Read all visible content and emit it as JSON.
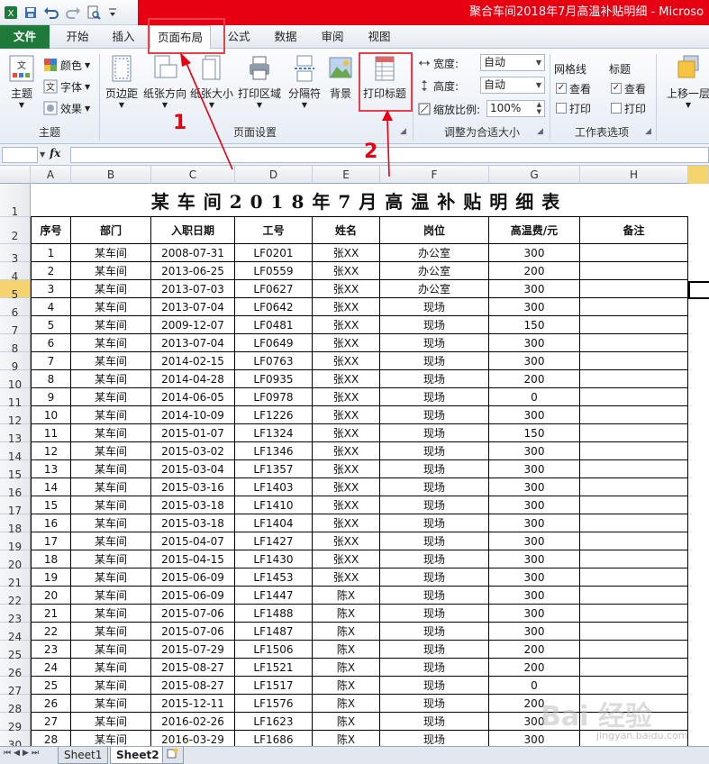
{
  "window": {
    "title": "聚合车间2018年7月高温补贴明细 - Microso"
  },
  "colors": {
    "title_bar_red": "#e60012",
    "file_tab": "#1d7a3a",
    "annotation_red": "#e60012"
  },
  "ribbon_tabs": [
    {
      "label": "文件"
    },
    {
      "label": "开始"
    },
    {
      "label": "插入"
    },
    {
      "label": "页面布局",
      "active": true
    },
    {
      "label": "公式"
    },
    {
      "label": "数据"
    },
    {
      "label": "审阅"
    },
    {
      "label": "视图"
    }
  ],
  "ribbon": {
    "theme": {
      "themes": "主题",
      "colors": "颜色",
      "fonts": "字体",
      "effects": "效果",
      "group": "主题"
    },
    "page_setup": {
      "margins": "页边距",
      "orientation": "纸张方向",
      "size": "纸张大小",
      "print_area": "打印区域",
      "breaks": "分隔符",
      "background": "背景",
      "print_titles": "打印标题",
      "group": "页面设置"
    },
    "scale": {
      "width_label": "宽度:",
      "width_value": "自动",
      "height_label": "高度:",
      "height_value": "自动",
      "scale_label": "缩放比例:",
      "scale_value": "100%",
      "group": "调整为合适大小"
    },
    "sheet_options": {
      "gridlines": "网格线",
      "headings": "标题",
      "view": "查看",
      "print": "打印",
      "group": "工作表选项"
    },
    "arrange": {
      "bring_forward": "上移一层"
    }
  },
  "formula_bar": {
    "fx": "fx",
    "value": ""
  },
  "columns": [
    "A",
    "B",
    "C",
    "D",
    "E",
    "F",
    "G",
    "H"
  ],
  "sheet": {
    "title": "某车间2018年7月高温补贴明细表",
    "headers": [
      "序号",
      "部门",
      "入职日期",
      "工号",
      "姓名",
      "岗位",
      "高温费/元",
      "备注"
    ],
    "rows": [
      [
        "1",
        "某车间",
        "2008-07-31",
        "LF0201",
        "张XX",
        "办公室",
        "300",
        ""
      ],
      [
        "2",
        "某车间",
        "2013-06-25",
        "LF0559",
        "张XX",
        "办公室",
        "200",
        ""
      ],
      [
        "3",
        "某车间",
        "2013-07-03",
        "LF0627",
        "张XX",
        "办公室",
        "300",
        ""
      ],
      [
        "4",
        "某车间",
        "2013-07-04",
        "LF0642",
        "张XX",
        "现场",
        "300",
        ""
      ],
      [
        "5",
        "某车间",
        "2009-12-07",
        "LF0481",
        "张XX",
        "现场",
        "150",
        ""
      ],
      [
        "6",
        "某车间",
        "2013-07-04",
        "LF0649",
        "张XX",
        "现场",
        "300",
        ""
      ],
      [
        "7",
        "某车间",
        "2014-02-15",
        "LF0763",
        "张XX",
        "现场",
        "300",
        ""
      ],
      [
        "8",
        "某车间",
        "2014-04-28",
        "LF0935",
        "张XX",
        "现场",
        "200",
        ""
      ],
      [
        "9",
        "某车间",
        "2014-06-05",
        "LF0978",
        "张XX",
        "现场",
        "0",
        ""
      ],
      [
        "10",
        "某车间",
        "2014-10-09",
        "LF1226",
        "张XX",
        "现场",
        "300",
        ""
      ],
      [
        "11",
        "某车间",
        "2015-01-07",
        "LF1324",
        "张XX",
        "现场",
        "150",
        ""
      ],
      [
        "12",
        "某车间",
        "2015-03-02",
        "LF1346",
        "张XX",
        "现场",
        "300",
        ""
      ],
      [
        "13",
        "某车间",
        "2015-03-04",
        "LF1357",
        "张XX",
        "现场",
        "300",
        ""
      ],
      [
        "14",
        "某车间",
        "2015-03-16",
        "LF1403",
        "张XX",
        "现场",
        "300",
        ""
      ],
      [
        "15",
        "某车间",
        "2015-03-18",
        "LF1410",
        "张XX",
        "现场",
        "300",
        ""
      ],
      [
        "16",
        "某车间",
        "2015-03-18",
        "LF1404",
        "张XX",
        "现场",
        "300",
        ""
      ],
      [
        "17",
        "某车间",
        "2015-04-07",
        "LF1427",
        "张XX",
        "现场",
        "300",
        ""
      ],
      [
        "18",
        "某车间",
        "2015-04-15",
        "LF1430",
        "张XX",
        "现场",
        "300",
        ""
      ],
      [
        "19",
        "某车间",
        "2015-06-09",
        "LF1453",
        "张XX",
        "现场",
        "300",
        ""
      ],
      [
        "20",
        "某车间",
        "2015-06-09",
        "LF1447",
        "陈X",
        "现场",
        "300",
        ""
      ],
      [
        "21",
        "某车间",
        "2015-07-06",
        "LF1488",
        "陈X",
        "现场",
        "300",
        ""
      ],
      [
        "22",
        "某车间",
        "2015-07-06",
        "LF1487",
        "陈X",
        "现场",
        "300",
        ""
      ],
      [
        "23",
        "某车间",
        "2015-07-29",
        "LF1506",
        "陈X",
        "现场",
        "200",
        ""
      ],
      [
        "24",
        "某车间",
        "2015-08-27",
        "LF1521",
        "陈X",
        "现场",
        "200",
        ""
      ],
      [
        "25",
        "某车间",
        "2015-08-27",
        "LF1517",
        "陈X",
        "现场",
        "0",
        ""
      ],
      [
        "26",
        "某车间",
        "2015-12-11",
        "LF1576",
        "陈X",
        "现场",
        "200",
        ""
      ],
      [
        "27",
        "某车间",
        "2016-02-26",
        "LF1623",
        "陈X",
        "现场",
        "300",
        ""
      ],
      [
        "28",
        "某车间",
        "2016-03-29",
        "LF1686",
        "陈X",
        "现场",
        "300",
        ""
      ]
    ]
  },
  "sheet_tabs": [
    "Sheet1",
    "Sheet2"
  ],
  "annotations": {
    "label1": "1",
    "label2": "2"
  },
  "watermark": {
    "text": "Bai 经验",
    "sub": "jingyan.baidu.com"
  }
}
